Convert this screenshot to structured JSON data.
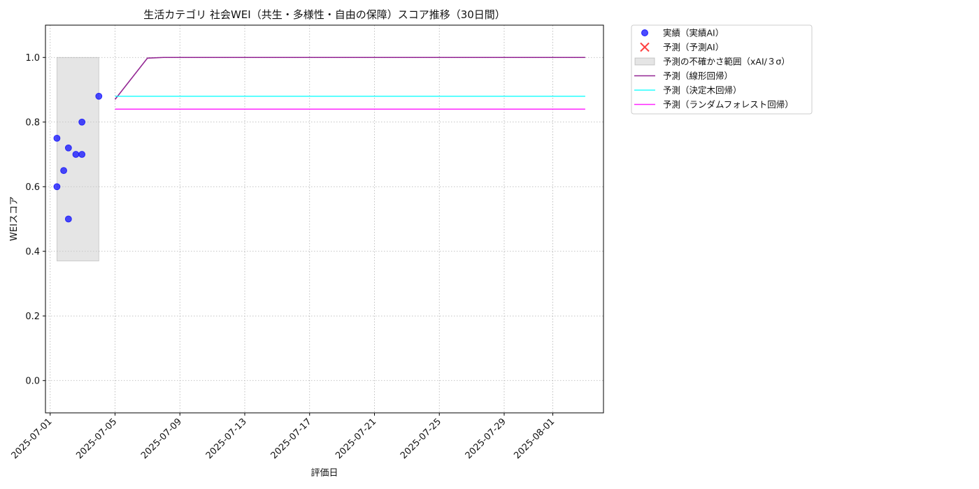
{
  "chart_data": {
    "type": "line",
    "title": "生活カテゴリ 社会WEI（共生・多様性・自由の保障）スコア推移（30日間）",
    "xlabel": "評価日",
    "ylabel": "WEIスコア",
    "ylim": [
      -0.1,
      1.1
    ],
    "y_ticks": [
      0.0,
      0.2,
      0.4,
      0.6,
      0.8,
      1.0
    ],
    "y_tick_labels": [
      "0.0",
      "0.2",
      "0.4",
      "0.6",
      "0.8",
      "1.0"
    ],
    "xlim": [
      "2025-06-30T17:00",
      "2025-08-04T03:00"
    ],
    "x_ticks": [
      "2025-07-01",
      "2025-07-05",
      "2025-07-09",
      "2025-07-13",
      "2025-07-17",
      "2025-07-21",
      "2025-07-25",
      "2025-07-29",
      "2025-08-01"
    ],
    "grid": true,
    "legend_position": "outside upper right",
    "actual": {
      "name": "実績（実績AI）",
      "color": "#0000ff",
      "points": [
        {
          "x": "2025-07-01T10:00",
          "y": 0.75
        },
        {
          "x": "2025-07-01T10:00",
          "y": 0.6
        },
        {
          "x": "2025-07-01T20:00",
          "y": 0.65
        },
        {
          "x": "2025-07-02T03:00",
          "y": 0.72
        },
        {
          "x": "2025-07-02T03:00",
          "y": 0.5
        },
        {
          "x": "2025-07-02T14:00",
          "y": 0.7
        },
        {
          "x": "2025-07-02T23:00",
          "y": 0.8
        },
        {
          "x": "2025-07-02T23:00",
          "y": 0.7
        },
        {
          "x": "2025-07-04T00:00",
          "y": 0.88
        }
      ]
    },
    "predicted_markers": {
      "name": "予測（予測AI）",
      "color": "#ff0000",
      "points": []
    },
    "uncertainty_band": {
      "name": "予測の不確かさ範囲（xAI/３σ）",
      "color": "#cccccc",
      "x": [
        "2025-07-01T10:00",
        "2025-07-04T00:00"
      ],
      "y_low": 0.37,
      "y_high": 1.0
    },
    "series": [
      {
        "name": "予測（線形回帰）",
        "color": "#800080",
        "points": [
          {
            "x": "2025-07-05",
            "y": 0.87
          },
          {
            "x": "2025-07-07",
            "y": 0.998
          },
          {
            "x": "2025-07-08",
            "y": 1.0
          },
          {
            "x": "2025-08-03",
            "y": 1.0
          }
        ]
      },
      {
        "name": "予測（決定木回帰）",
        "color": "#00ffff",
        "points": [
          {
            "x": "2025-07-05",
            "y": 0.88
          },
          {
            "x": "2025-08-03",
            "y": 0.88
          }
        ]
      },
      {
        "name": "予測（ランダムフォレスト回帰）",
        "color": "#ff00ff",
        "points": [
          {
            "x": "2025-07-05",
            "y": 0.84
          },
          {
            "x": "2025-08-03",
            "y": 0.84
          }
        ]
      }
    ]
  }
}
